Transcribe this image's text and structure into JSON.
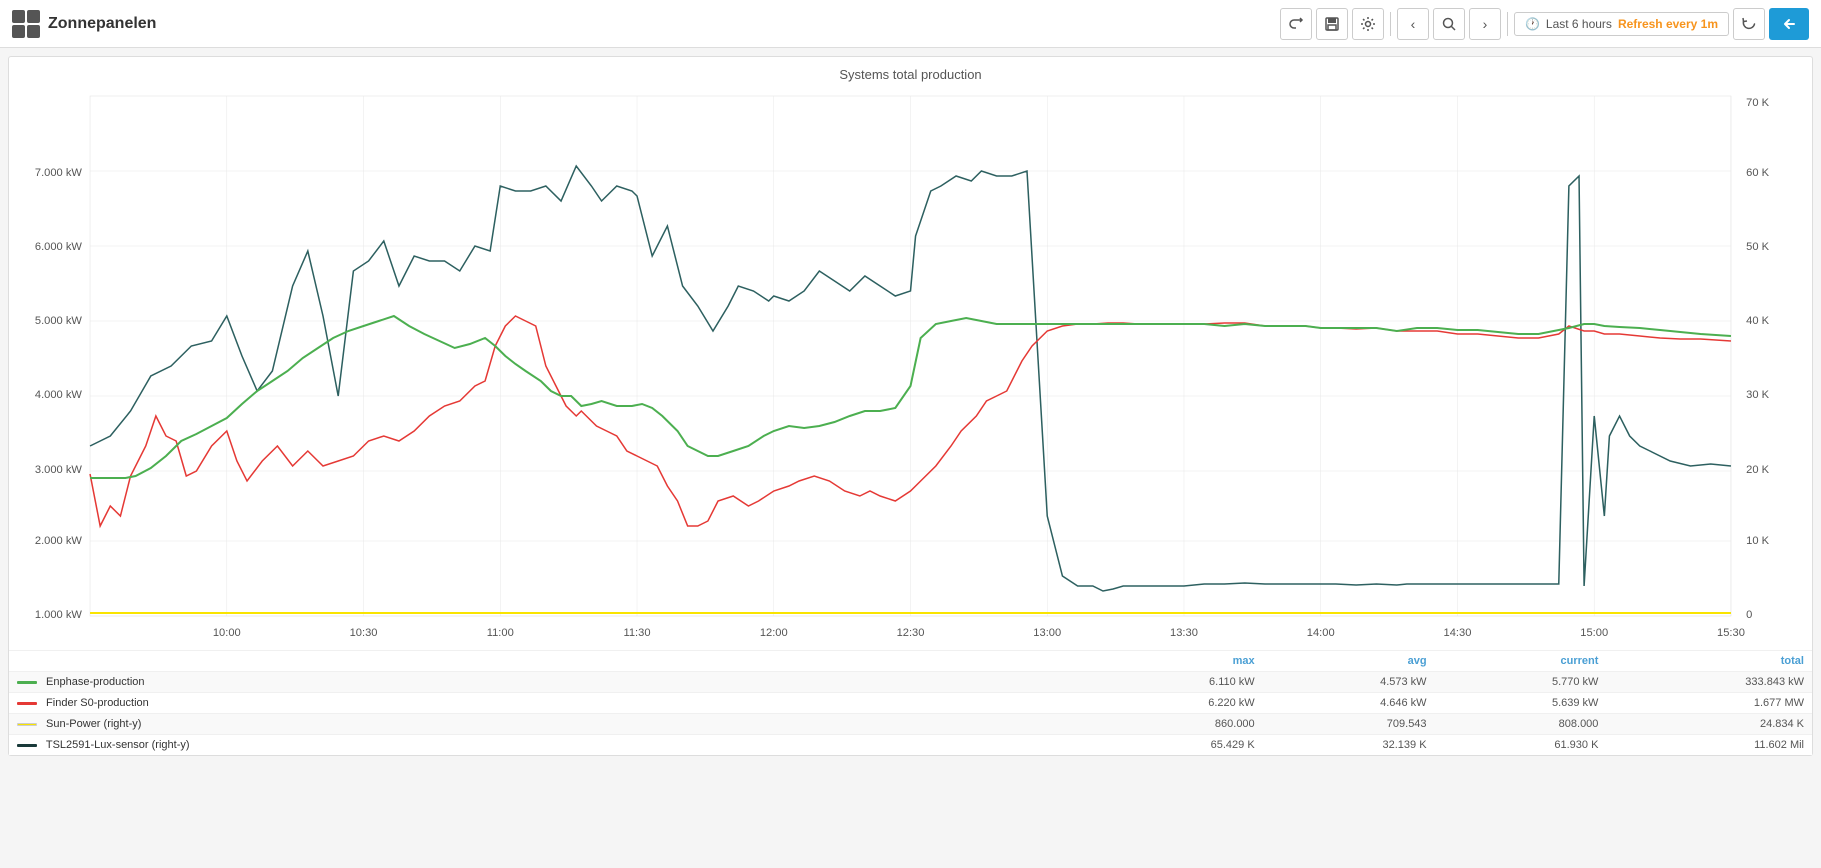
{
  "app": {
    "title": "Zonnepanelen"
  },
  "toolbar": {
    "share_label": "↗",
    "save_label": "💾",
    "settings_label": "⚙",
    "back_label": "‹",
    "zoom_label": "🔍",
    "forward_label": "›",
    "refresh_label": "↻",
    "go_label": "↩"
  },
  "time_range": {
    "icon": "🕐",
    "label": "Last 6 hours",
    "refresh": "Refresh every 1m"
  },
  "chart": {
    "title": "Systems total production",
    "y_axis_left": [
      "7.000 kW",
      "6.000 kW",
      "5.000 kW",
      "4.000 kW",
      "3.000 kW",
      "2.000 kW",
      "1.000 kW"
    ],
    "y_axis_right": [
      "70 K",
      "60 K",
      "50 K",
      "40 K",
      "30 K",
      "20 K",
      "10 K",
      "0"
    ],
    "x_axis": [
      "10:00",
      "10:30",
      "11:00",
      "11:30",
      "12:00",
      "12:30",
      "13:00",
      "13:30",
      "14:00",
      "14:30",
      "15:00",
      "15:30"
    ]
  },
  "legend": {
    "headers": {
      "max": "max",
      "avg": "avg",
      "current": "current",
      "total": "total"
    },
    "items": [
      {
        "name": "Enphase-production",
        "color": "#4caf50",
        "max": "6.110 kW",
        "avg": "4.573 kW",
        "current": "5.770 kW",
        "total": "333.843 kW"
      },
      {
        "name": "Finder S0-production",
        "color": "#e53935",
        "max": "6.220 kW",
        "avg": "4.646 kW",
        "current": "5.639 kW",
        "total": "1.677 MW"
      },
      {
        "name": "Sun-Power  (right-y)",
        "color": "#f9e400",
        "max": "860.000",
        "avg": "709.543",
        "current": "808.000",
        "total": "24.834 K"
      },
      {
        "name": "TSL2591-Lux-sensor  (right-y)",
        "color": "#1a3a3a",
        "max": "65.429 K",
        "avg": "32.139 K",
        "current": "61.930 K",
        "total": "11.602 Mil"
      }
    ]
  }
}
